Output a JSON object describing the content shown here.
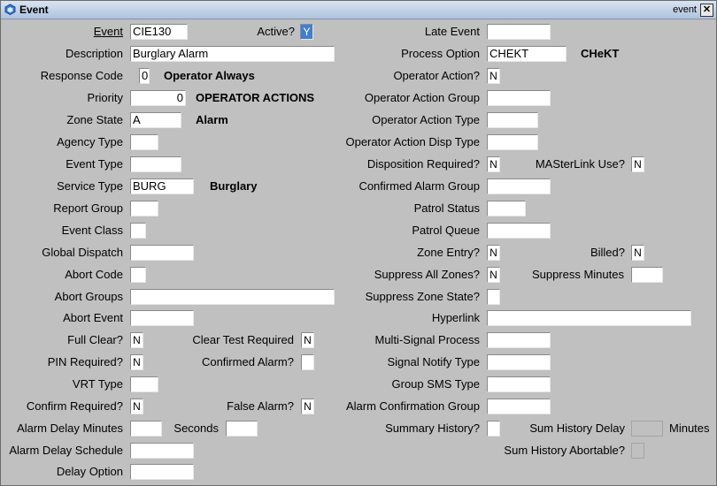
{
  "window": {
    "title": "Event",
    "title_right": "event",
    "close_glyph": "✕"
  },
  "left": {
    "event_label": "Event",
    "event_value": "CIE130",
    "active_label": "Active?",
    "active_value": "Y",
    "description_label": "Description",
    "description_value": "Burglary Alarm",
    "response_code_label": "Response Code",
    "response_code_value": "0",
    "response_code_desc": "Operator Always",
    "priority_label": "Priority",
    "priority_value": "0",
    "priority_desc": "OPERATOR ACTIONS",
    "zone_state_label": "Zone State",
    "zone_state_value": "A",
    "zone_state_desc": "Alarm",
    "agency_type_label": "Agency Type",
    "event_type_label": "Event Type",
    "service_type_label": "Service Type",
    "service_type_value": "BURG",
    "service_type_desc": "Burglary",
    "report_group_label": "Report Group",
    "event_class_label": "Event Class",
    "global_dispatch_label": "Global Dispatch",
    "abort_code_label": "Abort Code",
    "abort_groups_label": "Abort Groups",
    "abort_event_label": "Abort Event",
    "full_clear_label": "Full Clear?",
    "full_clear_value": "N",
    "clear_test_label": "Clear Test Required",
    "clear_test_value": "N",
    "pin_required_label": "PIN Required?",
    "pin_required_value": "N",
    "confirmed_alarm_label": "Confirmed Alarm?",
    "vrt_type_label": "VRT Type",
    "confirm_required_label": "Confirm Required?",
    "confirm_required_value": "N",
    "false_alarm_label": "False Alarm?",
    "false_alarm_value": "N",
    "alarm_delay_minutes_label": "Alarm Delay Minutes",
    "seconds_label": "Seconds",
    "alarm_delay_schedule_label": "Alarm Delay Schedule",
    "delay_option_label": "Delay Option"
  },
  "right": {
    "late_event_label": "Late Event",
    "process_option_label": "Process Option",
    "process_option_value": "CHEKT",
    "process_option_desc": "CHeKT",
    "operator_action_label": "Operator Action?",
    "operator_action_value": "N",
    "operator_action_group_label": "Operator Action Group",
    "operator_action_type_label": "Operator Action Type",
    "operator_action_disp_type_label": "Operator Action Disp Type",
    "disposition_required_label": "Disposition Required?",
    "disposition_required_value": "N",
    "masterlink_use_label": "MASterLink Use?",
    "masterlink_use_value": "N",
    "confirmed_alarm_group_label": "Confirmed Alarm Group",
    "patrol_status_label": "Patrol Status",
    "patrol_queue_label": "Patrol Queue",
    "zone_entry_label": "Zone Entry?",
    "zone_entry_value": "N",
    "billed_label": "Billed?",
    "billed_value": "N",
    "suppress_all_zones_label": "Suppress All Zones?",
    "suppress_all_zones_value": "N",
    "suppress_minutes_label": "Suppress Minutes",
    "suppress_zone_state_label": "Suppress Zone State?",
    "hyperlink_label": "Hyperlink",
    "multi_signal_label": "Multi-Signal Process",
    "signal_notify_label": "Signal Notify Type",
    "group_sms_label": "Group SMS Type",
    "alarm_confirmation_group_label": "Alarm Confirmation Group",
    "summary_history_label": "Summary History?",
    "summary_history_delay_label": "Sum History Delay",
    "minutes_label": "Minutes",
    "summary_history_abortable_label": "Sum History Abortable?"
  }
}
